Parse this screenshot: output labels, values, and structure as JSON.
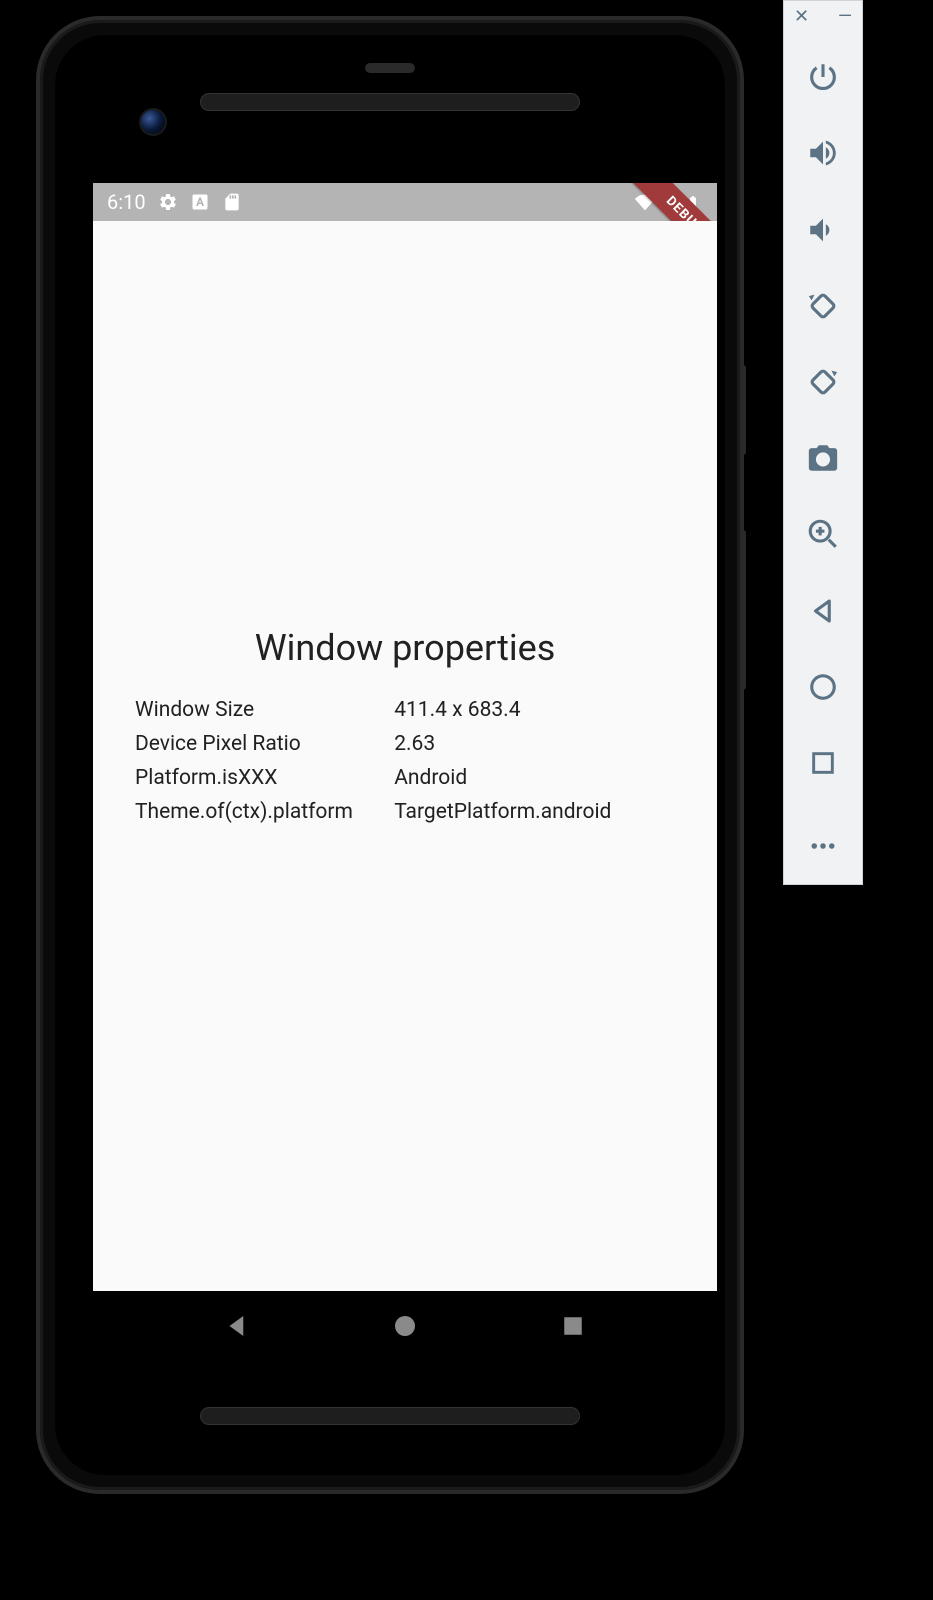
{
  "status_bar": {
    "time": "6:10"
  },
  "debug_label": "DEBUG",
  "page": {
    "title": "Window properties",
    "rows": [
      {
        "label": "Window Size",
        "value": "411.4 x 683.4"
      },
      {
        "label": "Device Pixel Ratio",
        "value": "2.63"
      },
      {
        "label": "Platform.isXXX",
        "value": "Android"
      },
      {
        "label": "Theme.of(ctx).platform",
        "value": "TargetPlatform.android"
      }
    ]
  }
}
